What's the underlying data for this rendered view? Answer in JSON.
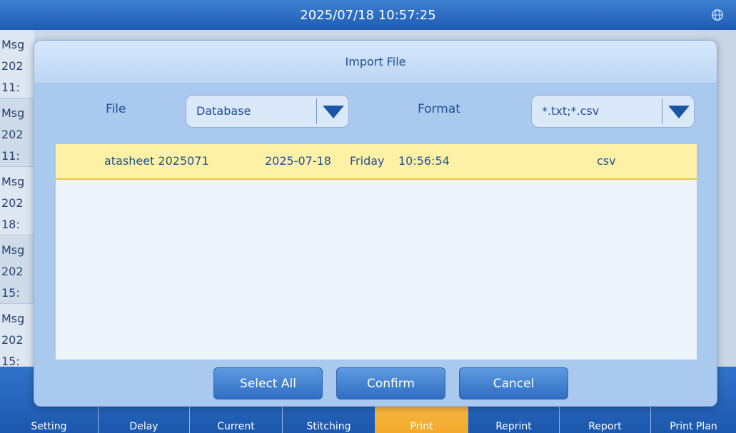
{
  "topbar": {
    "datetime": "2025/07/18 10:57:25"
  },
  "background_messages": [
    [
      "Msg",
      "202",
      "11:"
    ],
    [
      "Msg",
      "202",
      "11:"
    ],
    [
      "Msg",
      "202",
      "18:"
    ],
    [
      "Msg",
      "202",
      "15:"
    ],
    [
      "Msg",
      "202",
      "15:"
    ]
  ],
  "bottom_nav": [
    "Setting",
    "Delay",
    "Current",
    "Stitching",
    "Print",
    "Reprint",
    "Report",
    "Print Plan"
  ],
  "active_nav": "Print",
  "dialog": {
    "title": "Import File",
    "file_label": "File",
    "file_value": "Database",
    "format_label": "Format",
    "format_value": "*.txt;*.csv",
    "row": {
      "name": "atasheet 2025071",
      "date": "2025-07-18",
      "weekday": "Friday",
      "time": "10:56:54",
      "type": "csv"
    },
    "buttons": [
      "Select All",
      "Confirm",
      "Cancel"
    ]
  }
}
